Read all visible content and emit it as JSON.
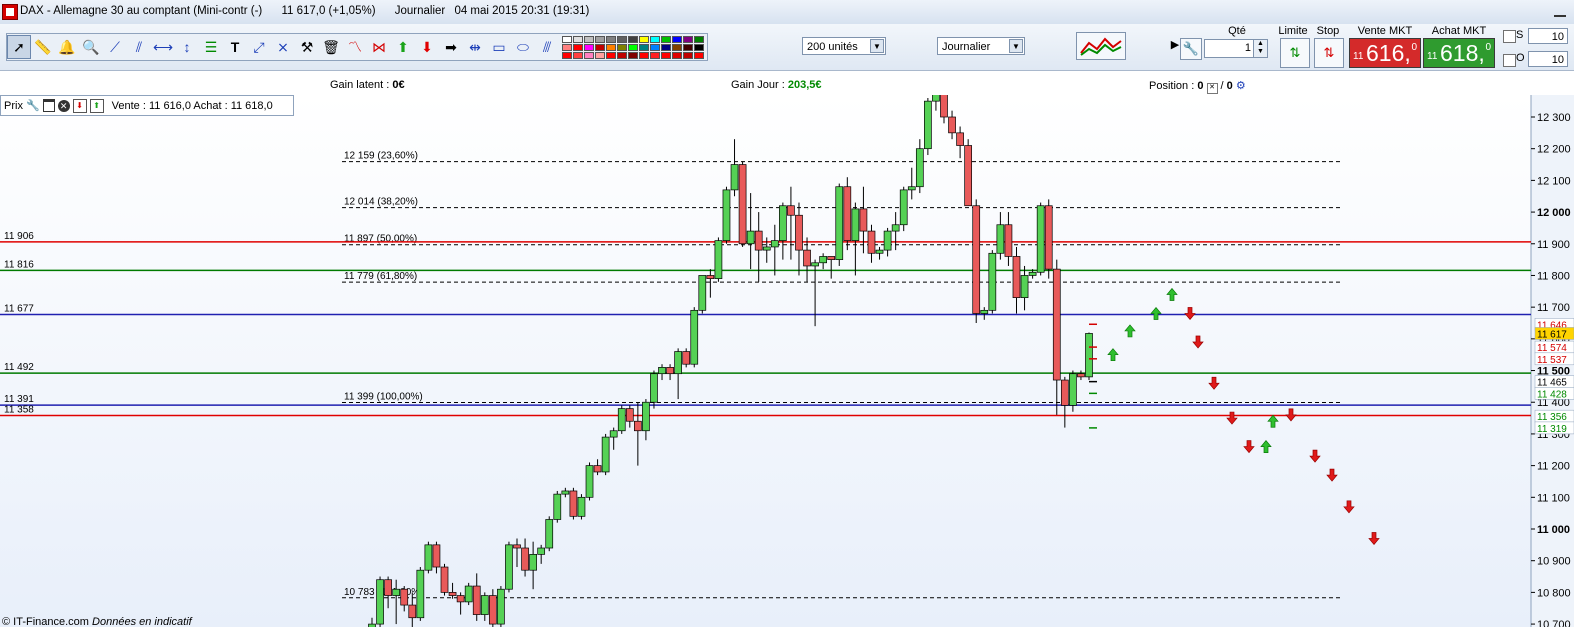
{
  "window": {
    "symbol": "DAX - Allemagne 30 au comptant (Mini-contr (-)",
    "last": "11 617,0 (+1,05%)",
    "period": "Journalier",
    "datetime": "04 mai 2015 20:31 (19:31)"
  },
  "toolbar": {
    "units_select": "200 unités",
    "period_select": "Journalier",
    "palette_colors": [
      "#ffffff",
      "#e0e0e0",
      "#c0c0c0",
      "#a0a0a0",
      "#808080",
      "#606060",
      "#404040",
      "#ffff00",
      "#00ffff",
      "#00c000",
      "#0000ff",
      "#800080",
      "#008000",
      "#ff8080",
      "#ff0000",
      "#ff00ff",
      "#c00000",
      "#ff8000",
      "#808000",
      "#00ff00",
      "#008080",
      "#0080ff",
      "#000080",
      "#804000",
      "#400000",
      "#000000",
      "#ff0000",
      "#ff4040",
      "#ff80c0",
      "#ffa0a0",
      "#ff0000",
      "#c00000",
      "#800000",
      "#ff0000",
      "#ff2020",
      "#ff0000",
      "#e00000",
      "#c00000",
      "#ff0000"
    ],
    "tool_icons": [
      "cursor-icon",
      "ruler-icon",
      "alarm-icon",
      "magnifier-icon",
      "trendline-icon",
      "parallel-line-icon",
      "horizontal-line-icon",
      "vertical-line-icon",
      "fibonacci-icon",
      "text-icon",
      "arrows-icon",
      "cross-lines-icon",
      "hammer-icon",
      "trash-icon",
      "signal-chart-icon",
      "fan-icon",
      "up-arrow-icon",
      "down-arrow-icon",
      "right-arrow-icon",
      "double-arrow-icon",
      "rectangle-icon",
      "ellipse-icon",
      "channel-icon"
    ]
  },
  "trade": {
    "qty_label": "Qté",
    "qty_value": "1",
    "limit_label": "Limite",
    "stop_label": "Stop",
    "sell_label": "Vente MKT",
    "buy_label": "Achat MKT",
    "sell_small": "11",
    "sell_big": "616,",
    "sell_dec": "0",
    "buy_small": "11",
    "buy_big": "618,",
    "buy_dec": "0",
    "s_label": "S",
    "o_label": "O",
    "s_value": "10",
    "o_value": "10",
    "sell_color": "#d42a2a",
    "buy_color": "#2f9b2f"
  },
  "info": {
    "gain_latent_label": "Gain latent :",
    "gain_latent_value": "0€",
    "gain_jour_label": "Gain Jour :",
    "gain_jour_value": "203,5€",
    "position_label": "Position :",
    "position_a": "0",
    "position_b": "0"
  },
  "legend": {
    "label": "Prix",
    "quote": "Vente : 11 616,0 Achat : 11 618,0"
  },
  "footer": {
    "copyright": "© IT-Finance.com",
    "note": "Données en indicatif"
  },
  "chart_data": {
    "type": "candlestick",
    "ylim": [
      10700,
      12350
    ],
    "y_ticks": [
      "12 300",
      "12 200",
      "12 100",
      "12 000",
      "11 900",
      "11 800",
      "11 700",
      "11 600",
      "11 500",
      "11 400",
      "11 300",
      "11 200",
      "11 100",
      "11 000",
      "10 900",
      "10 800",
      "10 700"
    ],
    "y_tick_values": [
      12300,
      12200,
      12100,
      12000,
      11900,
      11800,
      11700,
      11600,
      11500,
      11400,
      11300,
      11200,
      11100,
      11000,
      10900,
      10800,
      10700
    ],
    "horizontal_lines": [
      {
        "label": "11 906",
        "value": 11906,
        "color": "#e00000"
      },
      {
        "label": "11 816",
        "value": 11816,
        "color": "#007a00"
      },
      {
        "label": "11 677",
        "value": 11677,
        "color": "#2020b0"
      },
      {
        "label": "11 492",
        "value": 11492,
        "color": "#007a00"
      },
      {
        "label": "11 391",
        "value": 11391,
        "color": "#2020b0"
      },
      {
        "label": "11 358",
        "value": 11358,
        "color": "#e00000"
      }
    ],
    "fibonacci": [
      {
        "label": "12 159 (23,60%)",
        "value": 12159
      },
      {
        "label": "12 014 (38,20%)",
        "value": 12014
      },
      {
        "label": "11 897 (50,00%)",
        "value": 11897
      },
      {
        "label": "11 779 (61,80%)",
        "value": 11779
      },
      {
        "label": "11 399 (100,00%)",
        "value": 11399
      },
      {
        "label": "10 783 (161,80%)",
        "value": 10783
      }
    ],
    "price_tags": [
      {
        "label": "11 646",
        "value": 11646,
        "color": "#d40000",
        "bg": "#ffffff"
      },
      {
        "label": "11 617",
        "value": 11617,
        "color": "#000000",
        "bg": "#ffd400"
      },
      {
        "label": "11 574",
        "value": 11574,
        "color": "#d40000",
        "bg": "#ffffff"
      },
      {
        "label": "11 537",
        "value": 11537,
        "color": "#d40000",
        "bg": "#ffffff"
      },
      {
        "label": "11 465",
        "value": 11465,
        "color": "#000000",
        "bg": "#ffffff"
      },
      {
        "label": "11 428",
        "value": 11428,
        "color": "#008a00",
        "bg": "#ffffff"
      },
      {
        "label": "11 356",
        "value": 11356,
        "color": "#008a00",
        "bg": "#ffffff"
      },
      {
        "label": "11 319",
        "value": 11319,
        "color": "#008a00",
        "bg": "#ffffff"
      }
    ],
    "candles": [
      [
        10680,
        10720,
        10650,
        10700
      ],
      [
        10700,
        10850,
        10690,
        10840
      ],
      [
        10840,
        10850,
        10750,
        10790
      ],
      [
        10790,
        10840,
        10700,
        10810
      ],
      [
        10810,
        10820,
        10740,
        10760
      ],
      [
        10760,
        10800,
        10690,
        10720
      ],
      [
        10720,
        10880,
        10710,
        10870
      ],
      [
        10870,
        10960,
        10860,
        10950
      ],
      [
        10950,
        10960,
        10860,
        10880
      ],
      [
        10880,
        10890,
        10790,
        10800
      ],
      [
        10800,
        10830,
        10780,
        10790
      ],
      [
        10790,
        10800,
        10730,
        10770
      ],
      [
        10770,
        10830,
        10760,
        10820
      ],
      [
        10820,
        10860,
        10710,
        10730
      ],
      [
        10730,
        10800,
        10710,
        10790
      ],
      [
        10790,
        10810,
        10690,
        10700
      ],
      [
        10700,
        10820,
        10690,
        10810
      ],
      [
        10810,
        10960,
        10800,
        10950
      ],
      [
        10950,
        10970,
        10880,
        10940
      ],
      [
        10940,
        10970,
        10850,
        10870
      ],
      [
        10870,
        10960,
        10810,
        10920
      ],
      [
        10920,
        10950,
        10890,
        10940
      ],
      [
        10940,
        11040,
        10930,
        11030
      ],
      [
        11030,
        11120,
        11020,
        11110
      ],
      [
        11110,
        11130,
        11100,
        11120
      ],
      [
        11120,
        11130,
        11030,
        11040
      ],
      [
        11040,
        11110,
        11030,
        11100
      ],
      [
        11100,
        11210,
        11090,
        11200
      ],
      [
        11200,
        11220,
        11170,
        11180
      ],
      [
        11180,
        11300,
        11170,
        11290
      ],
      [
        11290,
        11320,
        11250,
        11310
      ],
      [
        11310,
        11390,
        11300,
        11380
      ],
      [
        11380,
        11390,
        11320,
        11340
      ],
      [
        11340,
        11400,
        11200,
        11310
      ],
      [
        11310,
        11410,
        11280,
        11400
      ],
      [
        11400,
        11500,
        11380,
        11490
      ],
      [
        11490,
        11520,
        11470,
        11510
      ],
      [
        11510,
        11520,
        11470,
        11490
      ],
      [
        11490,
        11570,
        11410,
        11560
      ],
      [
        11560,
        11570,
        11510,
        11520
      ],
      [
        11520,
        11700,
        11510,
        11690
      ],
      [
        11690,
        11760,
        11680,
        11800
      ],
      [
        11800,
        11820,
        11730,
        11790
      ],
      [
        11790,
        11920,
        11780,
        11910
      ],
      [
        11910,
        12080,
        11900,
        12070
      ],
      [
        12070,
        12230,
        12050,
        12150
      ],
      [
        12150,
        12160,
        11890,
        11900
      ],
      [
        11900,
        12060,
        11820,
        11940
      ],
      [
        11940,
        12000,
        11780,
        11880
      ],
      [
        11880,
        11920,
        11840,
        11890
      ],
      [
        11890,
        11960,
        11800,
        11910
      ],
      [
        11910,
        12030,
        11850,
        12020
      ],
      [
        12020,
        12080,
        11850,
        11990
      ],
      [
        11990,
        12030,
        11800,
        11880
      ],
      [
        11880,
        11920,
        11780,
        11830
      ],
      [
        11830,
        11850,
        11640,
        11840
      ],
      [
        11840,
        11870,
        11820,
        11860
      ],
      [
        11860,
        11860,
        11790,
        11850
      ],
      [
        11850,
        12090,
        11830,
        12080
      ],
      [
        12080,
        12110,
        11880,
        11910
      ],
      [
        11910,
        12030,
        11800,
        12010
      ],
      [
        12010,
        12080,
        11870,
        11940
      ],
      [
        11940,
        11960,
        11840,
        11870
      ],
      [
        11870,
        11890,
        11850,
        11880
      ],
      [
        11880,
        11950,
        11860,
        11940
      ],
      [
        11940,
        12000,
        11880,
        11960
      ],
      [
        11960,
        12080,
        11940,
        12070
      ],
      [
        12070,
        12140,
        12040,
        12080
      ],
      [
        12080,
        12230,
        12060,
        12200
      ],
      [
        12200,
        12360,
        12180,
        12350
      ],
      [
        12350,
        12420,
        12320,
        12380
      ],
      [
        12380,
        12390,
        12280,
        12300
      ],
      [
        12300,
        12320,
        12230,
        12250
      ],
      [
        12250,
        12270,
        12170,
        12210
      ],
      [
        12210,
        12230,
        12050,
        12020
      ],
      [
        12020,
        12040,
        11650,
        11680
      ],
      [
        11680,
        11700,
        11660,
        11690
      ],
      [
        11690,
        11880,
        11680,
        11870
      ],
      [
        11870,
        12000,
        11850,
        11960
      ],
      [
        11960,
        12000,
        11830,
        11860
      ],
      [
        11860,
        11890,
        11680,
        11730
      ],
      [
        11730,
        11830,
        11690,
        11800
      ],
      [
        11800,
        11820,
        11790,
        11810
      ],
      [
        11810,
        12030,
        11800,
        12020
      ],
      [
        12020,
        12040,
        11790,
        11820
      ],
      [
        11820,
        11850,
        11360,
        11470
      ],
      [
        11470,
        11480,
        11320,
        11390
      ],
      [
        11390,
        11500,
        11370,
        11490
      ],
      [
        11490,
        11500,
        11470,
        11480
      ],
      [
        11480,
        11620,
        11470,
        11617
      ]
    ],
    "arrows": [
      {
        "dir": "up",
        "value": 11550
      },
      {
        "dir": "up",
        "value": 11625
      },
      {
        "dir": "up",
        "value": 11680
      },
      {
        "dir": "up",
        "value": 11740
      },
      {
        "dir": "down",
        "value": 11680
      },
      {
        "dir": "down",
        "value": 11590
      },
      {
        "dir": "down",
        "value": 11460
      },
      {
        "dir": "down",
        "value": 11350
      },
      {
        "dir": "down",
        "value": 11260
      },
      {
        "dir": "up",
        "value": 11260
      },
      {
        "dir": "up",
        "value": 11340
      },
      {
        "dir": "down",
        "value": 11360
      },
      {
        "dir": "down",
        "value": 11230
      },
      {
        "dir": "down",
        "value": 11170
      },
      {
        "dir": "down",
        "value": 11070
      },
      {
        "dir": "down",
        "value": 10970
      }
    ]
  }
}
